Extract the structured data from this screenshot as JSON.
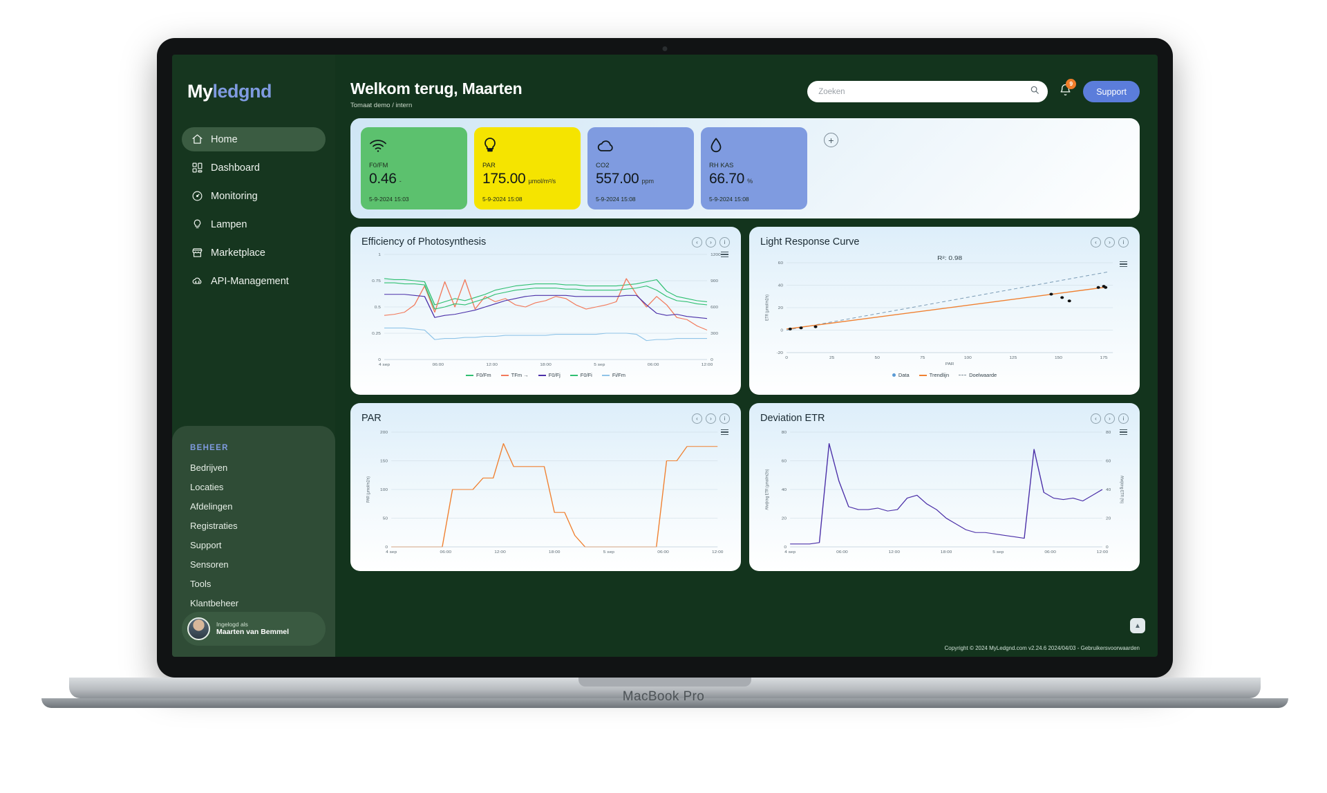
{
  "device": {
    "label": "MacBook Pro"
  },
  "brand": {
    "part1": "My",
    "part2": "ledgnd"
  },
  "sidebar": {
    "items": [
      {
        "label": "Home",
        "icon": "home-icon",
        "active": true
      },
      {
        "label": "Dashboard",
        "icon": "dashboard-icon",
        "active": false
      },
      {
        "label": "Monitoring",
        "icon": "gauge-icon",
        "active": false
      },
      {
        "label": "Lampen",
        "icon": "bulb-icon",
        "active": false
      },
      {
        "label": "Marketplace",
        "icon": "store-icon",
        "active": false
      },
      {
        "label": "API-Management",
        "icon": "cloud-code-icon",
        "active": false
      }
    ],
    "beheer": {
      "title": "BEHEER",
      "items": [
        "Bedrijven",
        "Locaties",
        "Afdelingen",
        "Registraties",
        "Support",
        "Sensoren",
        "Tools",
        "Klantbeheer"
      ]
    },
    "user": {
      "caption": "Ingelogd als",
      "name": "Maarten van Bemmel"
    }
  },
  "header": {
    "title": "Welkom terug, Maarten",
    "subtitle": "Tomaat demo / intern",
    "search_placeholder": "Zoeken",
    "search_value": "",
    "notification_count": "9",
    "support_label": "Support"
  },
  "kpis": [
    {
      "label": "F0/FM",
      "value": "0.46",
      "unit": "-",
      "date": "5-9-2024 15:03",
      "color": "#5cc16e",
      "icon": "wifi-icon"
    },
    {
      "label": "PAR",
      "value": "175.00",
      "unit": "µmol/m²/s",
      "date": "5-9-2024 15:08",
      "color": "#f5e400",
      "icon": "bulb-icon"
    },
    {
      "label": "CO2",
      "value": "557.00",
      "unit": "ppm",
      "date": "5-9-2024 15:08",
      "color": "#7f9be0",
      "icon": "cloud-icon"
    },
    {
      "label": "RH KAS",
      "value": "66.70",
      "unit": "%",
      "date": "5-9-2024 15:08",
      "color": "#7f9be0",
      "icon": "droplet-icon"
    }
  ],
  "add_kpi_label": "+",
  "panel_buttons": [
    "‹",
    "›",
    "i"
  ],
  "panels": {
    "photosynthesis": {
      "title": "Efficiency of Photosynthesis"
    },
    "light_response": {
      "title": "Light Response Curve"
    },
    "par": {
      "title": "PAR"
    },
    "deviation": {
      "title": "Deviation ETR"
    }
  },
  "chart_data": [
    {
      "id": "photosynthesis",
      "type": "line",
      "title": "Efficiency of Photosynthesis",
      "xlabel": "",
      "ylabel": "",
      "ylim": [
        0,
        1
      ],
      "yticks": [
        "0",
        "0.25",
        "0.5",
        "0.75",
        "1"
      ],
      "y2lim": [
        0,
        1200
      ],
      "y2ticks": [
        "0",
        "300",
        "600",
        "900",
        "1200"
      ],
      "xticks": [
        "4 sep",
        "06:00",
        "12:00",
        "18:00",
        "5 sep",
        "06:00",
        "12:00"
      ],
      "grid": true,
      "legend_position": "bottom",
      "series": [
        {
          "name": "F0/Fm",
          "color": "#2fbf71",
          "values": [
            0.77,
            0.76,
            0.76,
            0.75,
            0.74,
            0.52,
            0.55,
            0.58,
            0.56,
            0.59,
            0.62,
            0.66,
            0.68,
            0.7,
            0.71,
            0.72,
            0.72,
            0.72,
            0.71,
            0.71,
            0.7,
            0.7,
            0.7,
            0.7,
            0.71,
            0.72,
            0.74,
            0.76,
            0.65,
            0.6,
            0.58,
            0.56,
            0.55
          ]
        },
        {
          "name": "TFm →",
          "color": "#f2795a",
          "values": [
            0.42,
            0.43,
            0.45,
            0.52,
            0.7,
            0.45,
            0.74,
            0.5,
            0.76,
            0.48,
            0.6,
            0.55,
            0.58,
            0.52,
            0.5,
            0.54,
            0.56,
            0.6,
            0.58,
            0.52,
            0.48,
            0.5,
            0.52,
            0.55,
            0.77,
            0.62,
            0.5,
            0.6,
            0.52,
            0.4,
            0.38,
            0.32,
            0.28
          ]
        },
        {
          "name": "F0/Fj",
          "color": "#4b2fa8",
          "values": [
            0.62,
            0.62,
            0.62,
            0.61,
            0.6,
            0.4,
            0.42,
            0.43,
            0.45,
            0.47,
            0.5,
            0.53,
            0.56,
            0.58,
            0.6,
            0.61,
            0.61,
            0.61,
            0.61,
            0.6,
            0.6,
            0.6,
            0.6,
            0.6,
            0.61,
            0.61,
            0.52,
            0.44,
            0.42,
            0.43,
            0.41,
            0.4,
            0.39
          ]
        },
        {
          "name": "F0/Fi",
          "color": "#2fbf71",
          "values": [
            0.73,
            0.73,
            0.72,
            0.72,
            0.71,
            0.48,
            0.5,
            0.53,
            0.52,
            0.55,
            0.58,
            0.62,
            0.64,
            0.66,
            0.67,
            0.68,
            0.68,
            0.68,
            0.67,
            0.67,
            0.66,
            0.66,
            0.66,
            0.66,
            0.67,
            0.68,
            0.7,
            0.66,
            0.6,
            0.56,
            0.55,
            0.53,
            0.52
          ]
        },
        {
          "name": "Fi/Fm",
          "color": "#8fc4e8",
          "values": [
            0.3,
            0.3,
            0.3,
            0.29,
            0.28,
            0.19,
            0.2,
            0.2,
            0.21,
            0.21,
            0.22,
            0.22,
            0.23,
            0.23,
            0.23,
            0.23,
            0.23,
            0.24,
            0.24,
            0.24,
            0.24,
            0.24,
            0.25,
            0.25,
            0.25,
            0.24,
            0.18,
            0.19,
            0.19,
            0.2,
            0.2,
            0.2,
            0.2
          ]
        }
      ]
    },
    {
      "id": "light_response",
      "type": "scatter",
      "title": "Light Response Curve",
      "annotation": "R²: 0.98",
      "xlabel": "PAR",
      "ylabel": "ETR (µmol/m2/s)",
      "xlim": [
        0,
        180
      ],
      "xticks": [
        "0",
        "25",
        "50",
        "75",
        "100",
        "125",
        "150",
        "175"
      ],
      "ylim": [
        -20,
        60
      ],
      "yticks": [
        "-20",
        "0",
        "20",
        "40",
        "60"
      ],
      "grid": true,
      "legend_position": "bottom",
      "legend": [
        "Data",
        "Trendlijn",
        "Doelwaarde"
      ],
      "points": [
        [
          2,
          1
        ],
        [
          8,
          2
        ],
        [
          16,
          3
        ],
        [
          146,
          32
        ],
        [
          152,
          29
        ],
        [
          156,
          26
        ],
        [
          172,
          38
        ],
        [
          175,
          39
        ],
        [
          176,
          38
        ]
      ],
      "trend": {
        "name": "Trendlijn",
        "color": "#f08030",
        "points": [
          [
            0,
            1
          ],
          [
            175,
            38
          ]
        ]
      },
      "target": {
        "name": "Doelwaarde",
        "color": "#7a9bb5",
        "style": "dashed",
        "points": [
          [
            0,
            0
          ],
          [
            178,
            52
          ]
        ]
      }
    },
    {
      "id": "par",
      "type": "line",
      "title": "PAR",
      "xlabel": "",
      "ylabel": "PAR (µmol/m2/s)",
      "ylim": [
        0,
        200
      ],
      "yticks": [
        "0",
        "50",
        "100",
        "150",
        "200"
      ],
      "xticks": [
        "4 sep",
        "06:00",
        "12:00",
        "18:00",
        "5 sep",
        "06:00",
        "12:00"
      ],
      "grid": true,
      "series": [
        {
          "name": "PAR",
          "color": "#f08030",
          "values": [
            0,
            0,
            0,
            0,
            0,
            0,
            100,
            100,
            100,
            120,
            120,
            180,
            140,
            140,
            140,
            140,
            60,
            60,
            20,
            0,
            0,
            0,
            0,
            0,
            0,
            0,
            0,
            150,
            150,
            175,
            175,
            175,
            175
          ]
        }
      ]
    },
    {
      "id": "deviation",
      "type": "line",
      "title": "Deviation ETR",
      "xlabel": "",
      "ylabel": "Afwijking ETR (µmol/m2/s)",
      "y2label": "Afwijking ETR (%)",
      "ylim": [
        0,
        80
      ],
      "yticks": [
        "0",
        "20",
        "40",
        "60",
        "80"
      ],
      "y2lim": [
        0,
        80
      ],
      "y2ticks": [
        "0",
        "20",
        "40",
        "60",
        "80"
      ],
      "xticks": [
        "4 sep",
        "06:00",
        "12:00",
        "18:00",
        "5 sep",
        "06:00",
        "12:00"
      ],
      "grid": true,
      "series": [
        {
          "name": "Afwijking ETR",
          "color": "#4b2fa8",
          "values": [
            2,
            2,
            2,
            3,
            72,
            46,
            28,
            26,
            26,
            27,
            25,
            26,
            34,
            36,
            30,
            26,
            20,
            16,
            12,
            10,
            10,
            9,
            8,
            7,
            6,
            68,
            38,
            34,
            33,
            34,
            32,
            36,
            40
          ]
        }
      ]
    }
  ],
  "footer": {
    "text": "Copyright © 2024 MyLedgnd.com   v2.24.6 2024/04/03 - Gebruikersvoorwaarden"
  },
  "scroll_top_label": "▲",
  "colors": {
    "sidebar": "#16361f",
    "accent_blue": "#5b7ddb",
    "brand_blue": "#7f9be0",
    "badge": "#f07d2a"
  }
}
